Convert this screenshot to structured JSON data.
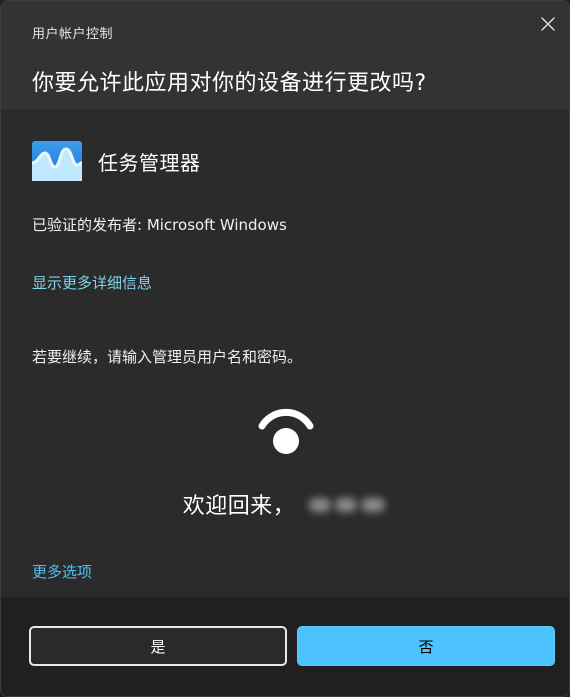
{
  "dialog": {
    "window_title": "用户帐户控制",
    "question": "你要允许此应用对你的设备进行更改吗?",
    "app": {
      "name": "任务管理器",
      "icon": "task-manager-icon"
    },
    "publisher": "已验证的发布者: Microsoft Windows",
    "details_link": "显示更多详细信息",
    "instruction": "若要继续，请输入管理员用户名和密码。",
    "welcome": "欢迎回来，",
    "more_options": "更多选项",
    "buttons": {
      "yes": "是",
      "no": "否"
    }
  },
  "colors": {
    "link": "#7fd3ea",
    "accent": "#4cc2ff",
    "header_bg": "#333333",
    "body_bg": "#2b2b2b",
    "footer_bg": "#202020"
  }
}
